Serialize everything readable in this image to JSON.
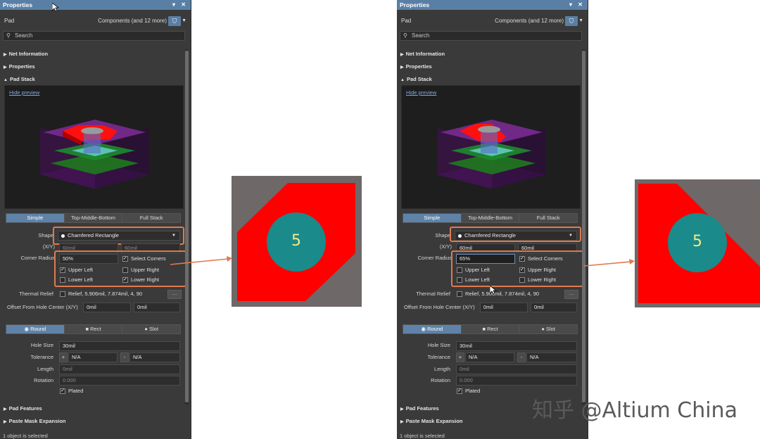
{
  "panels": [
    {
      "title": "Properties",
      "object": "Pad",
      "filter_summary": "Components (and 12 more)",
      "search_placeholder": "Search",
      "sections": {
        "net_info": "Net Information",
        "properties": "Properties",
        "pad_stack": "Pad Stack",
        "pad_features": "Pad Features",
        "paste_mask": "Paste Mask Expansion"
      },
      "hide_preview": "Hide preview",
      "stack_tabs": [
        "Simple",
        "Top-Middle-Bottom",
        "Full Stack"
      ],
      "shape_label": "Shape",
      "shape_value": "Chamfered Rectangle",
      "xy_label": "(X/Y)",
      "x_value": "60mil",
      "y_value": "60mil",
      "corner_label": "Corner Radius",
      "corner_value": "50%",
      "select_corners": "Select Corners",
      "corners": [
        {
          "label": "Upper Left",
          "checked": true
        },
        {
          "label": "Upper Right",
          "checked": false
        },
        {
          "label": "Lower Left",
          "checked": false
        },
        {
          "label": "Lower Right",
          "checked": true
        }
      ],
      "thermal_label": "Thermal Relief",
      "thermal_value": "Relief, 5.906mil, 7.874mil, 4, 90",
      "offset_label": "Offset From Hole Center (X/Y)",
      "offset_x": "0mil",
      "offset_y": "0mil",
      "hole_tabs": [
        "Round",
        "Rect",
        "Slot"
      ],
      "hole_size_label": "Hole Size",
      "hole_size": "30mil",
      "tolerance_label": "Tolerance",
      "tol_plus_sign": "+",
      "tol_plus": "N/A",
      "tol_minus_sign": "-",
      "tol_minus": "N/A",
      "length_label": "Length",
      "length_value": "0mil",
      "rotation_label": "Rotation",
      "rotation_value": "0.000",
      "plated_label": "Plated",
      "status": "1 object is selected"
    },
    {
      "title": "Properties",
      "object": "Pad",
      "filter_summary": "Components (and 12 more)",
      "search_placeholder": "Search",
      "sections": {
        "net_info": "Net Information",
        "properties": "Properties",
        "pad_stack": "Pad Stack",
        "pad_features": "Pad Features",
        "paste_mask": "Paste Mask Expansion"
      },
      "hide_preview": "Hide preview",
      "stack_tabs": [
        "Simple",
        "Top-Middle-Bottom",
        "Full Stack"
      ],
      "shape_label": "Shape",
      "shape_value": "Chamfered Rectangle",
      "xy_label": "(X/Y)",
      "x_value": "60mil",
      "y_value": "60mil",
      "corner_label": "Corner Radius",
      "corner_value": "65%",
      "select_corners": "Select Corners",
      "corners": [
        {
          "label": "Upper Left",
          "checked": false
        },
        {
          "label": "Upper Right",
          "checked": true
        },
        {
          "label": "Lower Left",
          "checked": false
        },
        {
          "label": "Lower Right",
          "checked": false
        }
      ],
      "thermal_label": "Thermal Relief",
      "thermal_value": "Relief, 5.906mil, 7.874mil, 4, 90",
      "offset_label": "Offset From Hole Center (X/Y)",
      "offset_x": "0mil",
      "offset_y": "0mil",
      "hole_tabs": [
        "Round",
        "Rect",
        "Slot"
      ],
      "hole_size_label": "Hole Size",
      "hole_size": "30mil",
      "tolerance_label": "Tolerance",
      "tol_plus_sign": "+",
      "tol_plus": "N/A",
      "tol_minus_sign": "-",
      "tol_minus": "N/A",
      "length_label": "Length",
      "length_value": "0mil",
      "rotation_label": "Rotation",
      "rotation_value": "0.000",
      "plated_label": "Plated",
      "status": "1 object is selected"
    }
  ],
  "details": [
    {
      "pad_number": "5",
      "chamfered_corners": [
        "upper-left",
        "lower-right"
      ]
    },
    {
      "pad_number": "5",
      "chamfered_corners": [
        "upper-right"
      ]
    }
  ],
  "colors": {
    "pad": "#ff0000",
    "hole": "#1a8a8a",
    "pad_number": "#f3e98a",
    "background": "#6e6868",
    "callout": "#e07a4e",
    "accent": "#5f83a8"
  },
  "watermark": "知乎 @Altium China"
}
